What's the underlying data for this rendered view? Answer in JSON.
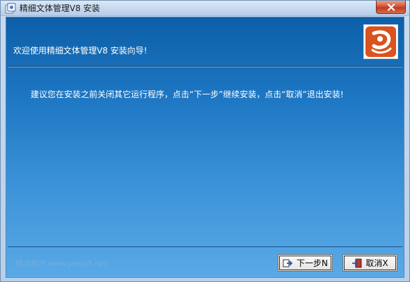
{
  "window": {
    "title": "精细文体管理V8 安装"
  },
  "wizard": {
    "header": "欢迎使用精细文体管理V8 安装向导!",
    "body": "建议您在安装之前关闭其它运行程序，点击“下一步”继续安装，点击“取消”退出安装!",
    "footer": "精达软件 www.yesoft.net"
  },
  "buttons": {
    "next": "下一步N",
    "cancel": "取消X"
  },
  "colors": {
    "accent": "#1d76c2",
    "logo": "#d9531f",
    "close": "#c23a22"
  },
  "icons": {
    "title": "installer-icon",
    "logo": "brand-logo-icon",
    "close": "close-icon",
    "next": "next-arrow-icon",
    "cancel": "exit-door-icon"
  }
}
